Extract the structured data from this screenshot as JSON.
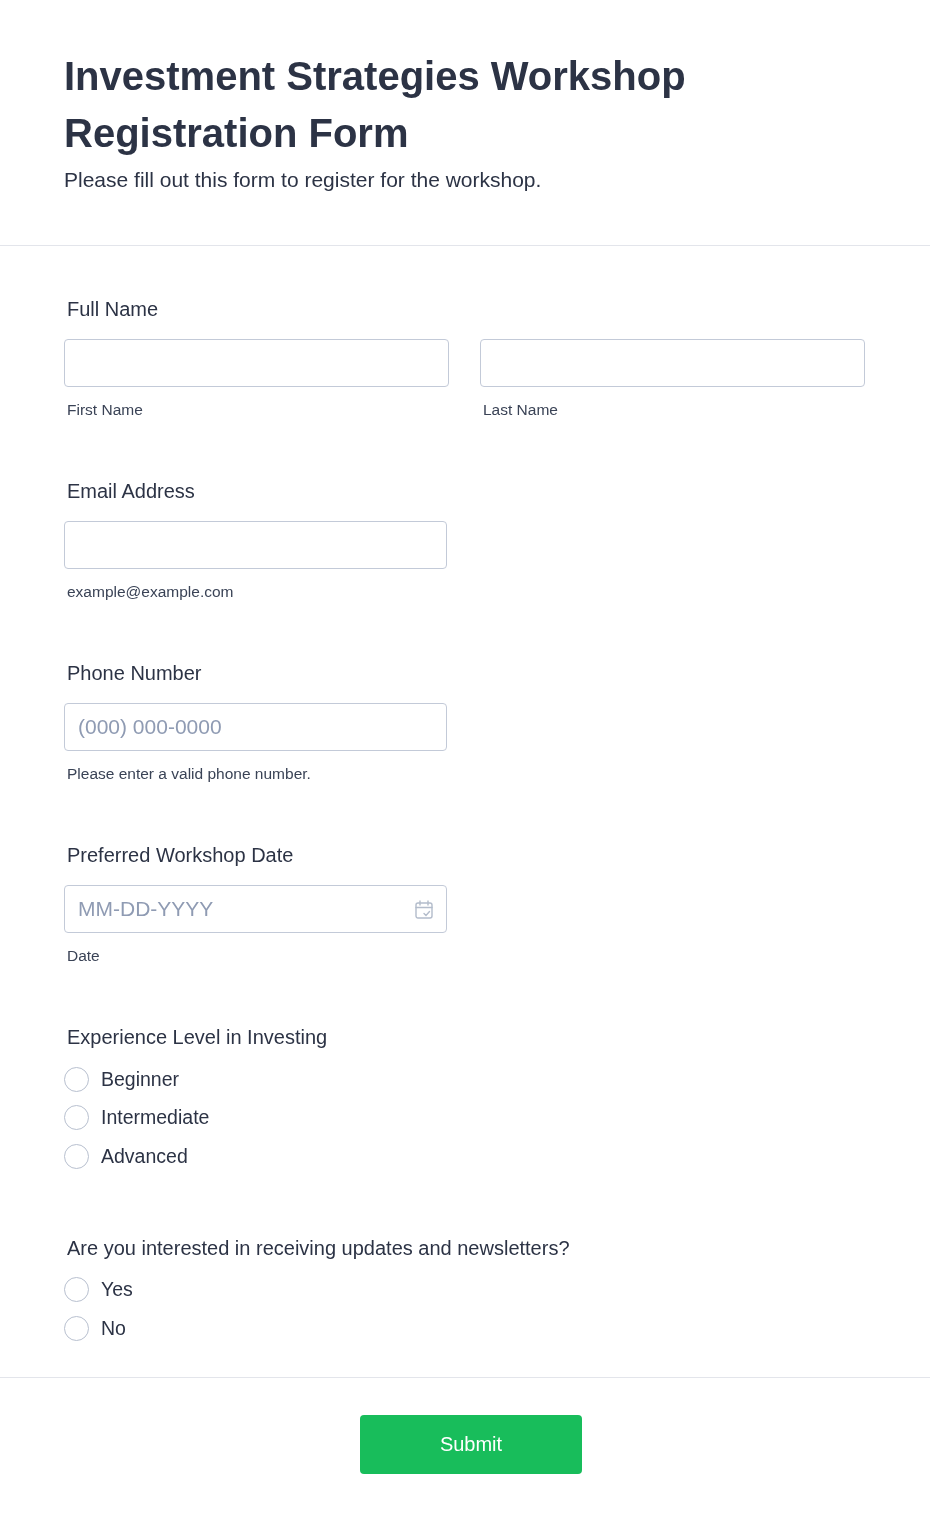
{
  "header": {
    "title": "Investment Strategies Workshop Registration Form",
    "subtitle": "Please fill out this form to register for the workshop."
  },
  "fields": [
    {
      "kind": "text",
      "label": "Full Name",
      "inputs": [
        {
          "sublabel": "First Name"
        },
        {
          "sublabel": "Last Name"
        }
      ]
    },
    {
      "kind": "text",
      "label": "Email Address",
      "inputs": [
        {
          "sublabel": "example@example.com"
        }
      ]
    },
    {
      "kind": "text",
      "label": "Phone Number",
      "inputs": [
        {
          "placeholder": "(000) 000-0000",
          "sublabel": "Please enter a valid phone number."
        }
      ]
    },
    {
      "kind": "date",
      "label": "Preferred Workshop Date",
      "inputs": [
        {
          "placeholder": "MM-DD-YYYY",
          "sublabel": "Date"
        }
      ]
    },
    {
      "kind": "radio",
      "label": "Experience Level in Investing",
      "options": [
        {
          "label": "Beginner",
          "selected": false
        },
        {
          "label": "Intermediate",
          "selected": false
        },
        {
          "label": "Advanced",
          "selected": false
        }
      ]
    },
    {
      "kind": "radio",
      "label": "Are you interested in receiving updates and newsletters?",
      "options": [
        {
          "label": "Yes",
          "selected": false
        },
        {
          "label": "No",
          "selected": false
        }
      ]
    }
  ],
  "submit": {
    "label": "Submit"
  }
}
